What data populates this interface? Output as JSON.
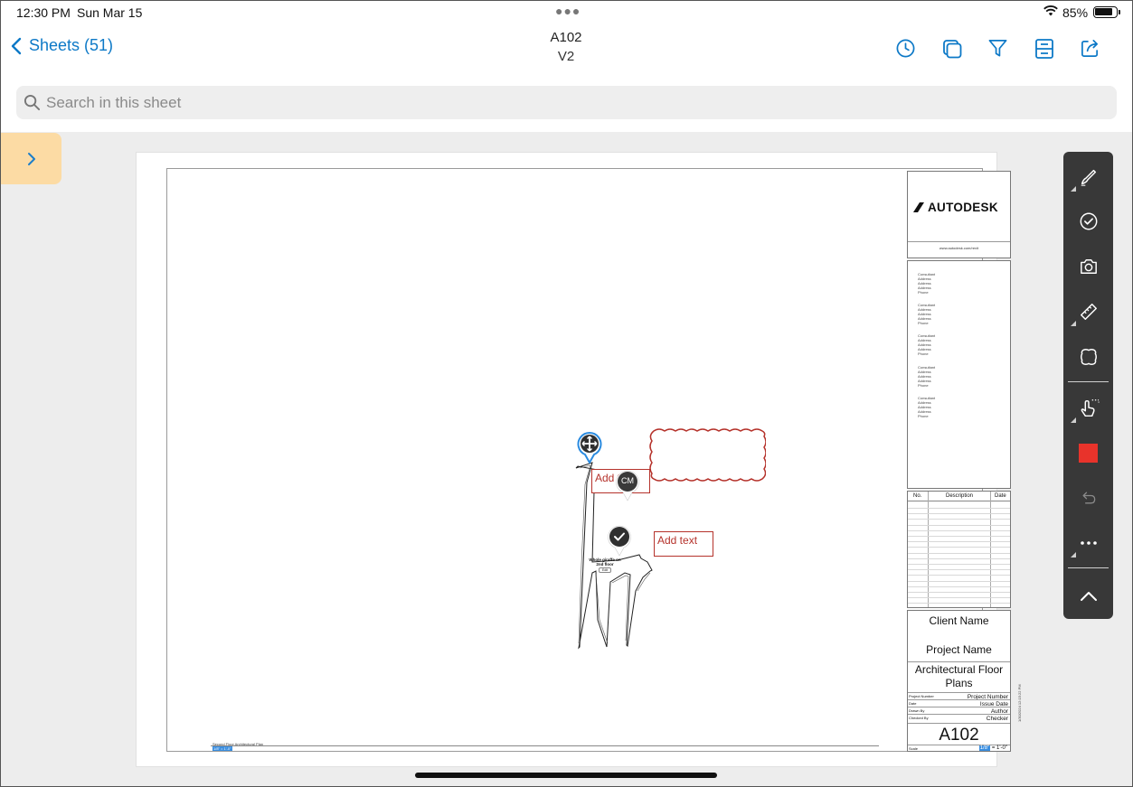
{
  "status": {
    "time": "12:30 PM",
    "date": "Sun Mar 15",
    "battery": "85%"
  },
  "nav": {
    "back_label": "Sheets (51)",
    "title": "A102",
    "subtitle": "V2",
    "icons": [
      "history-icon",
      "layers-icon",
      "filter-icon",
      "sheet-details-icon",
      "share-icon"
    ]
  },
  "search": {
    "placeholder": "Search in this sheet",
    "value": ""
  },
  "sheet": {
    "logo_text": "AUTODESK",
    "logo_url": "www.autodesk.com/revit",
    "consultants": [
      [
        "Consultant",
        "Address",
        "Address",
        "Address",
        "Phone"
      ],
      [
        "Consultant",
        "Address",
        "Address",
        "Address",
        "Phone"
      ],
      [
        "Consultant",
        "Address",
        "Address",
        "Address",
        "Phone"
      ],
      [
        "Consultant",
        "Address",
        "Address",
        "Address",
        "Phone"
      ],
      [
        "Consultant",
        "Address",
        "Address",
        "Address",
        "Phone"
      ]
    ],
    "revision_headers": {
      "no": "No.",
      "description": "Description",
      "date": "Date"
    },
    "client_name": "Client Name",
    "project_name": "Project Name",
    "drawing_title": "Architectural Floor Plans",
    "info_rows": [
      {
        "label": "Project Number",
        "value": "Project Number"
      },
      {
        "label": "Date",
        "value": "Issue Date"
      },
      {
        "label": "Drawn By",
        "value": "Author"
      },
      {
        "label": "Checked By",
        "value": "Checker"
      }
    ],
    "sheet_number": "A102",
    "scale_label": "Scale",
    "scale_value": "1/8\"",
    "scale_suffix": "= 1'-0\"",
    "stamp": "1/30/2024 12:15:22 PM",
    "view_title": "Second Floor Architectural Plan",
    "view_scale": "1/8\" = 1'-0\""
  },
  "markups": {
    "text_box_1": "Add text",
    "text_box_1_visible": "Add t",
    "text_box_2": "Add text",
    "comment_initials": "CM",
    "drawing_label": "Whole giraffe on 2nd floor",
    "drawing_sublabel": "Edit",
    "color": "#b5322b"
  },
  "toolbar": {
    "tools": [
      "pen-icon",
      "checkmark-icon",
      "camera-icon",
      "ruler-icon",
      "cloud-shape-icon",
      "touch-select-icon",
      "color-swatch",
      "undo-icon",
      "more-icon",
      "collapse-icon"
    ],
    "active_color": "#e8332b"
  }
}
